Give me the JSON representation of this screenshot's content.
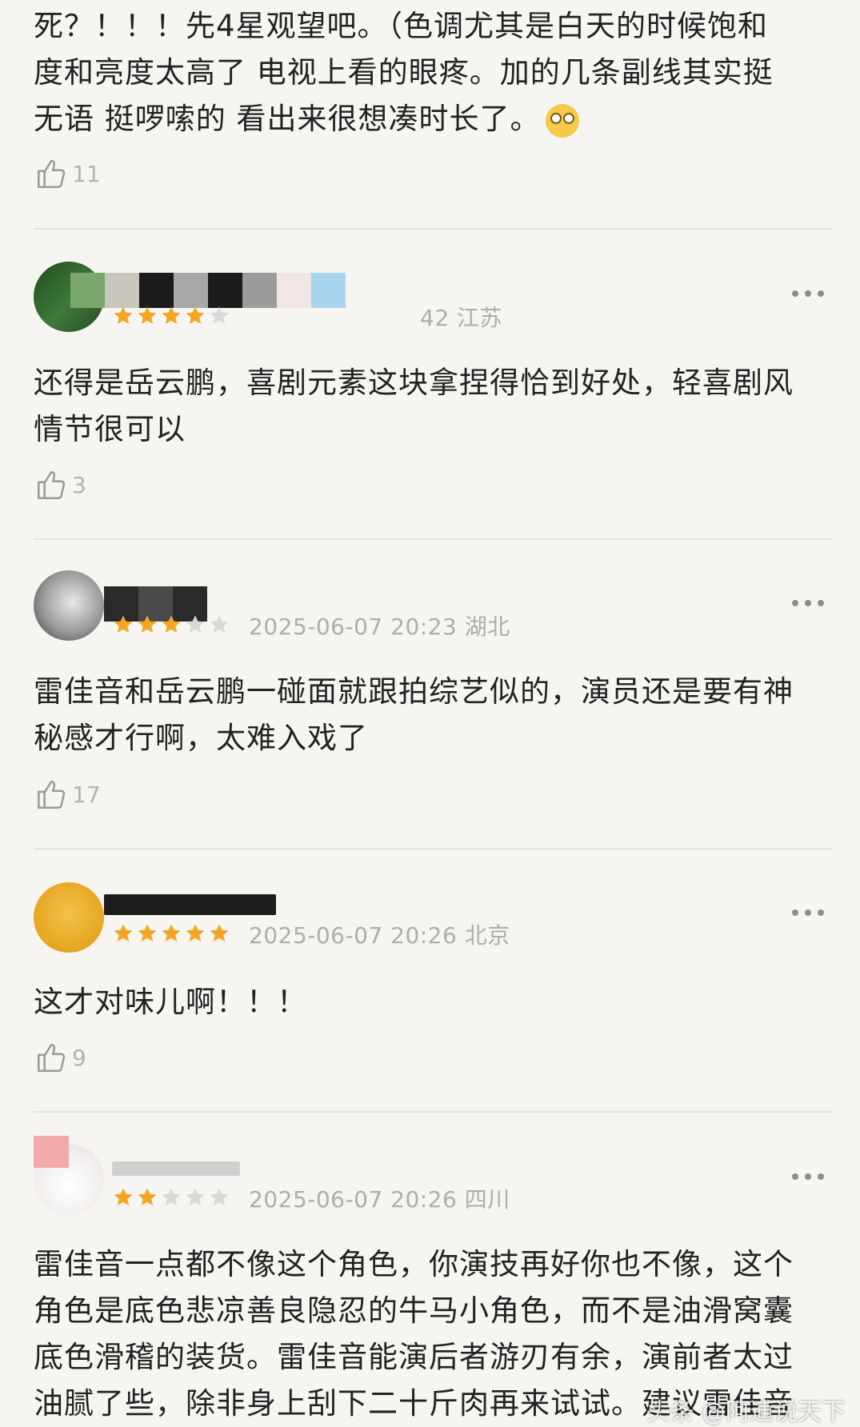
{
  "comments": [
    {
      "text_lines": [
        "死？！！！先4星观望吧。（色调尤其是白天的时候饱和",
        "度和亮度太高了 电视上看的眼疼。加的几条副线其实挺",
        "无语 挺啰嗦的 看出来很想凑时长了。"
      ],
      "emoji_icon": "face-with-rolling-eyes",
      "likes": "11"
    },
    {
      "name": "",
      "rating": 4,
      "meta": "42 江苏",
      "text_lines": [
        "还得是岳云鹏，喜剧元素这块拿捏得恰到好处，轻喜剧风",
        "情节很可以"
      ],
      "likes": "3"
    },
    {
      "name": "",
      "rating": 3,
      "meta": "2025-06-07 20:23 湖北",
      "text_lines": [
        "雷佳音和岳云鹏一碰面就跟拍综艺似的，演员还是要有神",
        "秘感才行啊，太难入戏了"
      ],
      "likes": "17"
    },
    {
      "name": "",
      "rating": 5,
      "meta": "2025-06-07 20:26 北京",
      "text_lines": [
        "这才对味儿啊！！！"
      ],
      "likes": "9"
    },
    {
      "name": "",
      "rating": 2,
      "meta": "2025-06-07 20:26 四川",
      "text_lines": [
        "雷佳音一点都不像这个角色，你演技再好你也不像，这个",
        "角色是底色悲凉善良隐忍的牛马小角色，而不是油滑窝囊",
        "底色滑稽的装货。雷佳音能演后者游刃有余，演前者太过",
        "油腻了些，除非身上刮下二十斤肉再来试试。建议雷佳音"
      ]
    }
  ],
  "watermark": "头条 @阿逋说天下",
  "colors": {
    "star_on": "#f4a623",
    "star_off": "#d9d9d9",
    "meta_text": "#adadad",
    "background": "#f6f5f1"
  }
}
